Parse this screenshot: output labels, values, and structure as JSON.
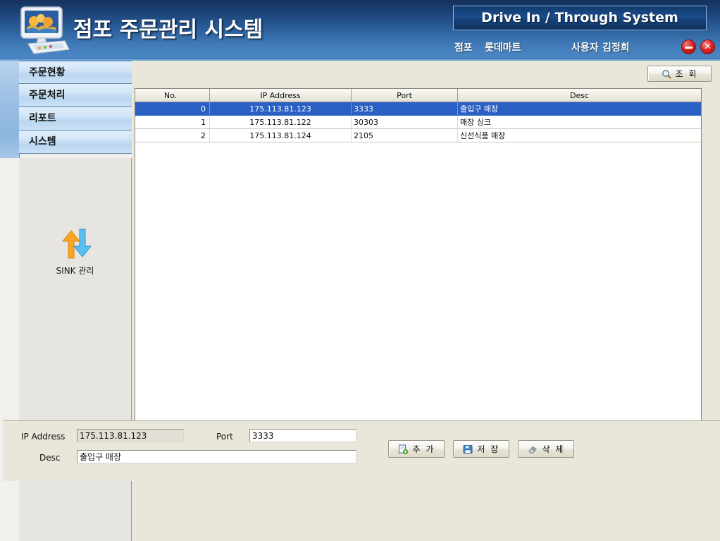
{
  "header": {
    "app_title": "점포 주문관리 시스템",
    "system_banner": "Drive In / Through System",
    "store_label": "점포",
    "store_value": "롯데마트",
    "user_label": "사용자",
    "user_value": "김정희",
    "minimize_tooltip": "최소화",
    "close_tooltip": "닫기",
    "logo_icon": "computer-monitor-icon",
    "colors": {
      "header_top": "#16325e",
      "header_bottom": "#4a86c3",
      "banner_bg": "#1b4e8c",
      "window_button_red": "#d62222"
    }
  },
  "sidebar": {
    "items": [
      {
        "label": "주문현황"
      },
      {
        "label": "주문처리"
      },
      {
        "label": "리포트"
      },
      {
        "label": "시스템"
      }
    ],
    "tool": {
      "label": "SINK 관리",
      "icon": "sync-arrows-icon",
      "up_arrow_color": "#f5a623",
      "down_arrow_color": "#4fb3e8"
    }
  },
  "toolbar": {
    "search_label": "조 회",
    "search_icon": "magnifier-icon"
  },
  "grid": {
    "columns": [
      {
        "key": "no",
        "label": "No."
      },
      {
        "key": "ip",
        "label": "IP Address"
      },
      {
        "key": "port",
        "label": "Port"
      },
      {
        "key": "desc",
        "label": "Desc"
      }
    ],
    "rows": [
      {
        "no": "0",
        "ip": "175.113.81.123",
        "port": "3333",
        "desc": "출입구 매장",
        "selected": true
      },
      {
        "no": "1",
        "ip": "175.113.81.122",
        "port": "30303",
        "desc": "매장 싱크",
        "selected": false
      },
      {
        "no": "2",
        "ip": "175.113.81.124",
        "port": "2105",
        "desc": "신선식품 매장",
        "selected": false
      }
    ],
    "selection_color": "#2a60c4"
  },
  "form": {
    "ip_label": "IP Address",
    "ip_value": "175.113.81.123",
    "port_label": "Port",
    "port_value": "3333",
    "desc_label": "Desc",
    "desc_value": "출입구 매장",
    "buttons": [
      {
        "id": "add",
        "label": "추 가",
        "icon": "new-page-plus-icon"
      },
      {
        "id": "save",
        "label": "저 장",
        "icon": "floppy-disk-icon"
      },
      {
        "id": "delete",
        "label": "삭 제",
        "icon": "eraser-icon"
      }
    ]
  }
}
